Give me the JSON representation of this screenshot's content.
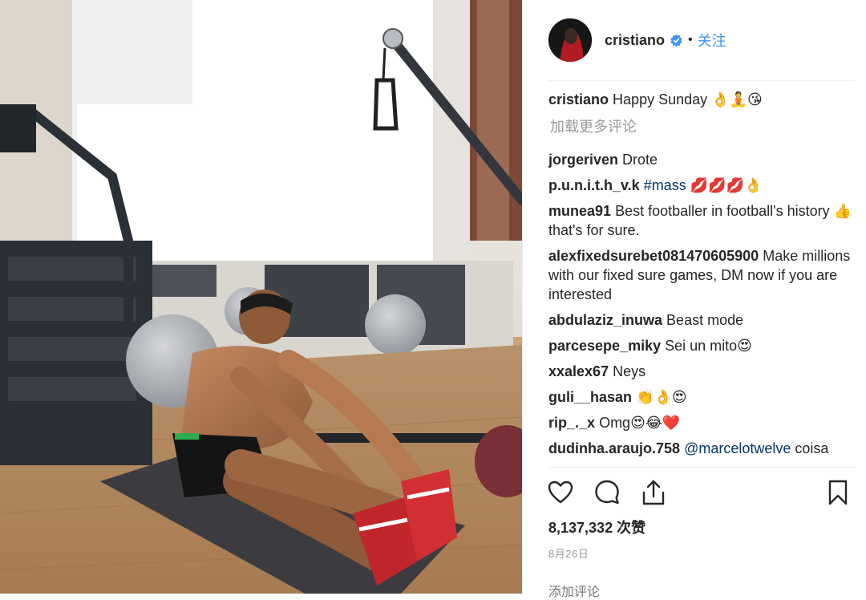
{
  "header": {
    "username": "cristiano",
    "separator": "•",
    "follow_label": "关注"
  },
  "caption": {
    "username": "cristiano",
    "text": "Happy Sunday 👌🧘😘"
  },
  "load_more_label": "加载更多评论",
  "comments": [
    {
      "username": "jorgeriven",
      "text": "Drote"
    },
    {
      "username": "p.u.n.i.t.h_v.k",
      "tag": "#mass",
      "text": " 💋💋💋👌"
    },
    {
      "username": "munea91",
      "text": "Best footballer in football's history 👍 that's for sure."
    },
    {
      "username": "alexfixedsurebet081470605900",
      "text": "Make millions with our fixed sure games, DM now if you are interested"
    },
    {
      "username": "abdulaziz_inuwa",
      "text": "Beast mode"
    },
    {
      "username": "parcesepe_miky",
      "text": "Sei un mito😍"
    },
    {
      "username": "xxalex67",
      "text": "Neys"
    },
    {
      "username": "guli__hasan",
      "text": "👏👌😍"
    },
    {
      "username": "rip_._x",
      "text": "Omg😍😂❤️"
    },
    {
      "username": "dudinha.araujo.758",
      "tag": "@marcelotwelve",
      "text": " coisa"
    }
  ],
  "actions": {
    "like_icon": "heart-icon",
    "comment_icon": "comment-icon",
    "share_icon": "share-icon",
    "save_icon": "bookmark-icon"
  },
  "likes": {
    "count": "8,137,332",
    "unit": " 次赞"
  },
  "date": "8月26日",
  "add_comment_placeholder": "添加评论",
  "colors": {
    "link_blue": "#3897f0",
    "hashtag_blue": "#003569",
    "muted_gray": "#999999",
    "verified_blue": "#3897f0"
  }
}
